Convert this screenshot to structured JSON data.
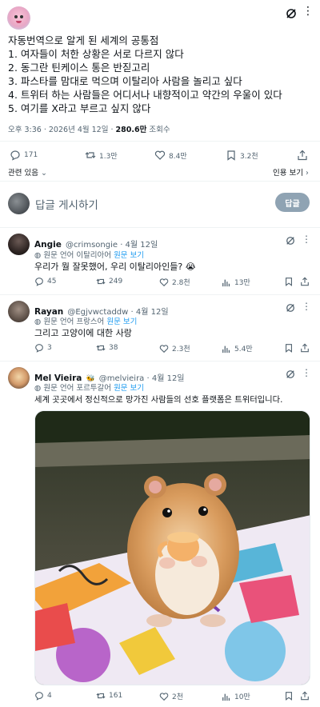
{
  "main_tweet": {
    "lines": [
      "자동번역으로 알게 된 세계의 공통점",
      "1. 여자들이 처한 상황은 서로 다르지 않다",
      "2. 동그란 틴케이스 통은 반짇고리",
      "3. 파스타를 맘대로 먹으며 이탈리아 사람을 놀리고 싶다",
      "4. 트위터 하는 사람들은 어디서나 내향적이고 약간의 우울이 있다",
      "5. 여기를 X라고 부르고 싶지 않다"
    ],
    "time": "오후 3:36 · 2026년 4월 12일 · ",
    "views_count": "280.6만",
    "views_label": " 조회수",
    "stats": {
      "replies": "171",
      "retweets": "1.3만",
      "likes": "8.4만",
      "bookmarks": "3.2천"
    },
    "related_label": "관련 있음",
    "quotes_label": "인용 보기"
  },
  "composer": {
    "placeholder": "답글 게시하기",
    "button": "답글"
  },
  "replies": [
    {
      "name": "Angie",
      "badge": "",
      "handle": "@crimsongie · 4월 12일",
      "translation_note": "원문 언어 이탈리아어",
      "translation_link": "원문 보기",
      "text": "우리가 뭘 잘못했어, 우리 이탈리아인들? 😭",
      "stats": {
        "replies": "45",
        "retweets": "249",
        "likes": "2.8천",
        "views": "13만"
      }
    },
    {
      "name": "Rayan",
      "badge": "",
      "handle": "@Egjvwctaddw · 4월 12일",
      "translation_note": "원문 언어 프랑스어",
      "translation_link": "원문 보기",
      "text": "그리고 고양이에 대한 사랑",
      "stats": {
        "replies": "3",
        "retweets": "38",
        "likes": "2.3천",
        "views": "5.4만"
      }
    },
    {
      "name": "Mel Vieira",
      "badge": "🐝",
      "handle": "@melvieira · 4월 12일",
      "translation_note": "원문 언어 포르투갈어",
      "translation_link": "원문 보기",
      "text": "세계 곳곳에서 정신적으로 망가진 사람들의 선호 플랫폼은 트위터입니다.",
      "stats": {
        "replies": "4",
        "retweets": "161",
        "likes": "2천",
        "views": "10만"
      }
    }
  ],
  "colors": {
    "accent": "#1d9bf0",
    "muted": "#536471",
    "divider": "#eff3f4"
  }
}
